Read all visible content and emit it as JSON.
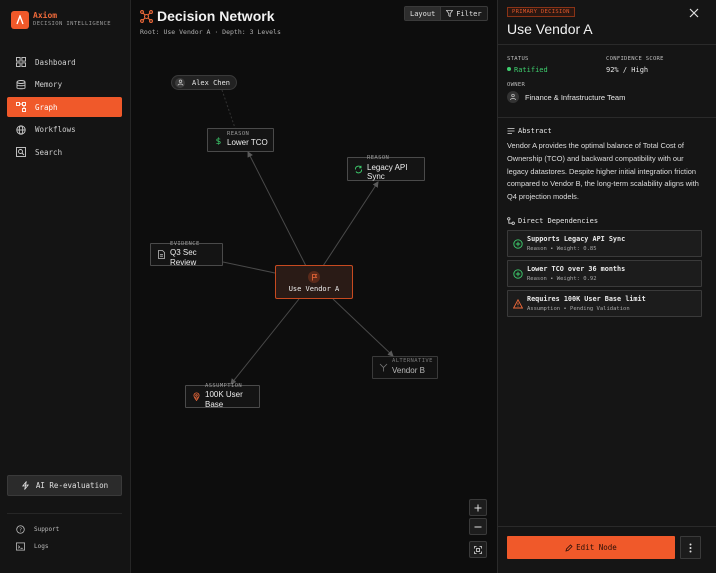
{
  "brand": {
    "name": "Axiom",
    "subtitle": "DECISION INTELLIGENCE"
  },
  "sidebar": {
    "items": [
      {
        "label": "Dashboard",
        "icon": "dashboard-icon",
        "active": false
      },
      {
        "label": "Memory",
        "icon": "database-icon",
        "active": false
      },
      {
        "label": "Graph",
        "icon": "graph-icon",
        "active": true
      },
      {
        "label": "Workflows",
        "icon": "globe-icon",
        "active": false
      },
      {
        "label": "Search",
        "icon": "search-icon",
        "active": false
      }
    ],
    "ai_button": "AI Re-evaluation",
    "footer": [
      {
        "label": "Support",
        "icon": "help-icon"
      },
      {
        "label": "Logs",
        "icon": "terminal-icon"
      }
    ]
  },
  "canvas": {
    "title": "Decision Network",
    "subtitle": "Root: Use Vendor A · Depth: 3 Levels",
    "toolbar": {
      "layout": "Layout",
      "filter": "Filter"
    },
    "person": "Alex Chen",
    "center": {
      "label": "Use Vendor A",
      "icon": "flag-icon"
    },
    "nodes": [
      {
        "kind": "REASON",
        "label": "Lower TCO",
        "icon": "dollar-icon"
      },
      {
        "kind": "REASON",
        "label": "Legacy API Sync",
        "icon": "sync-icon"
      },
      {
        "kind": "EVIDENCE",
        "label": "Q3 Sec Review",
        "icon": "document-icon"
      },
      {
        "kind": "ALTERNATIVE",
        "label": "Vendor B",
        "icon": "branch-icon"
      },
      {
        "kind": "ASSUMPTION",
        "label": "100K User Base",
        "icon": "pin-icon"
      }
    ]
  },
  "panel": {
    "badge": "PRIMARY DECISION",
    "title": "Use Vendor A",
    "status_label": "STATUS",
    "status_value": "Ratified",
    "confidence_label": "CONFIDENCE SCORE",
    "confidence_value": "92% / High",
    "owner_label": "OWNER",
    "owner": "Finance & Infrastructure Team",
    "abstract_heading": "Abstract",
    "abstract": "Vendor A provides the optimal balance of Total Cost of Ownership (TCO) and backward compatibility with our legacy datastores. Despite higher initial integration friction compared to Vendor B, the long-term scalability aligns with Q4 projection models.",
    "deps_heading": "Direct Dependencies",
    "dependencies": [
      {
        "title": "Supports Legacy API Sync",
        "meta": "Reason • Weight: 0.85",
        "icon": "plus-circle-icon"
      },
      {
        "title": "Lower TCO over 36 months",
        "meta": "Reason • Weight: 0.92",
        "icon": "plus-circle-icon"
      },
      {
        "title": "Requires 100K User Base limit",
        "meta": "Assumption • Pending Validation",
        "icon": "warning-icon"
      }
    ],
    "edit_button": "Edit Node"
  },
  "colors": {
    "accent": "#f0592a",
    "success": "#3ecf6e",
    "warning": "#f0592a"
  }
}
